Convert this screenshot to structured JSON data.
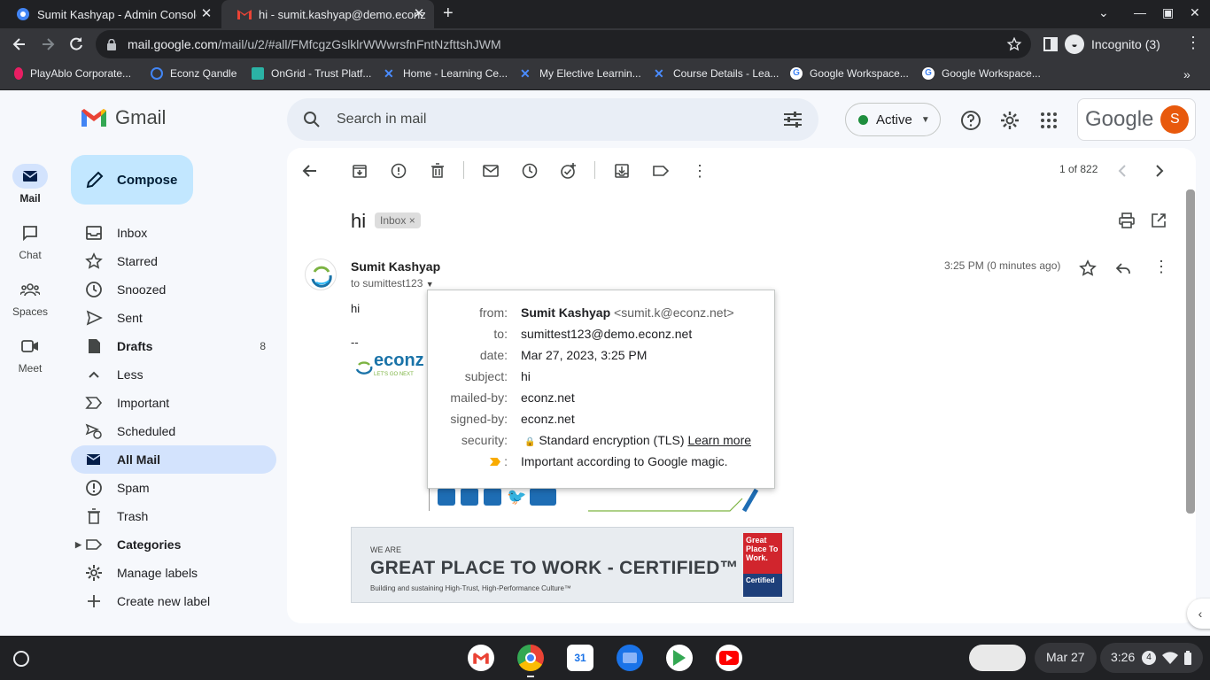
{
  "browser": {
    "tabs": [
      {
        "title": "Sumit Kashyap - Admin Console"
      },
      {
        "title": "hi - sumit.kashyap@demo.econz"
      }
    ],
    "url_host": "mail.google.com",
    "url_path": "/mail/u/2/#all/FMfcgzGslklrWWwrsfnFntNzfttshJWM",
    "incognito": "Incognito (3)",
    "bookmarks": [
      "PlayAblo Corporate...",
      "Econz Qandle",
      "OnGrid - Trust Platf...",
      "Home - Learning Ce...",
      "My Elective Learnin...",
      "Course Details - Lea...",
      "Google Workspace...",
      "Google Workspace..."
    ]
  },
  "gmail": {
    "brand": "Gmail",
    "search_placeholder": "Search in mail",
    "status": "Active",
    "google_word": "Google",
    "avatar_letter": "S",
    "rail": [
      "Mail",
      "Chat",
      "Spaces",
      "Meet"
    ],
    "compose": "Compose",
    "nav": [
      {
        "label": "Inbox"
      },
      {
        "label": "Starred"
      },
      {
        "label": "Snoozed"
      },
      {
        "label": "Sent"
      },
      {
        "label": "Drafts",
        "count": "8"
      },
      {
        "label": "Less"
      },
      {
        "label": "Important"
      },
      {
        "label": "Scheduled"
      },
      {
        "label": "All Mail"
      },
      {
        "label": "Spam"
      },
      {
        "label": "Trash"
      },
      {
        "label": "Categories"
      },
      {
        "label": "Manage labels"
      },
      {
        "label": "Create new label"
      }
    ]
  },
  "message": {
    "pager": "1 of 822",
    "subject": "hi",
    "label_chip": "Inbox",
    "sender": "Sumit Kashyap",
    "to_line": "to sumittest123",
    "time": "3:25 PM (0 minutes ago)",
    "body_text": "hi",
    "sig_dash": "--",
    "logo_text": "econz",
    "logo_tag": "LET'S GO NEXT",
    "banner_we_are": "WE ARE",
    "banner_title": "GREAT PLACE TO WORK - CERTIFIED™",
    "banner_sub": "Building and sustaining High-Trust, High-Performance Culture™",
    "badge_top": "Great Place To Work.",
    "badge_bottom": "Certified"
  },
  "details": {
    "from_key": "from:",
    "from_name": "Sumit Kashyap",
    "from_email": "<sumit.k@econz.net>",
    "to_key": "to:",
    "to_val": "sumittest123@demo.econz.net",
    "date_key": "date:",
    "date_val": "Mar 27, 2023, 3:25 PM",
    "subject_key": "subject:",
    "subject_val": "hi",
    "mailedby_key": "mailed-by:",
    "mailedby_val": "econz.net",
    "signedby_key": "signed-by:",
    "signedby_val": "econz.net",
    "security_key": "security:",
    "security_val": "Standard encryption (TLS)",
    "learn_more": "Learn more",
    "importance_key": ":",
    "importance_val": "Important according to Google magic."
  },
  "shelf": {
    "date": "Mar 27",
    "time": "3:26",
    "notif_count": "4"
  }
}
